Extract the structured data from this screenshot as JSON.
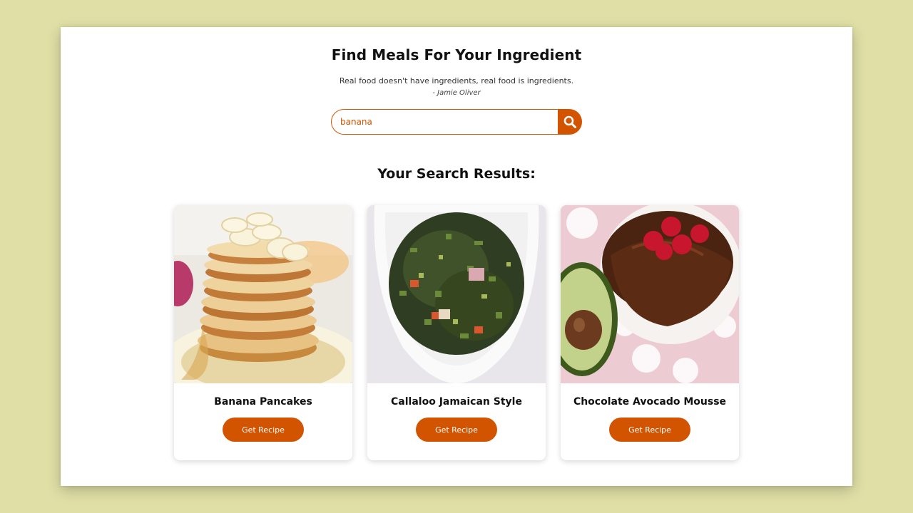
{
  "header": {
    "title": "Find Meals For Your Ingredient",
    "quote": "Real food doesn't have ingredients, real food is ingredients.",
    "quote_author": "- Jamie Oliver"
  },
  "search": {
    "value": "banana",
    "button_icon": "search-icon"
  },
  "results": {
    "title": "Your Search Results:",
    "items": [
      {
        "name": "Banana Pancakes",
        "button_label": "Get Recipe",
        "image": "banana-pancakes-image"
      },
      {
        "name": "Callaloo Jamaican Style",
        "button_label": "Get Recipe",
        "image": "callaloo-image"
      },
      {
        "name": "Chocolate Avocado Mousse",
        "button_label": "Get Recipe",
        "image": "chocolate-avocado-mousse-image"
      }
    ]
  },
  "colors": {
    "background": "#dfdfa6",
    "accent": "#d35400",
    "panel": "#ffffff"
  }
}
